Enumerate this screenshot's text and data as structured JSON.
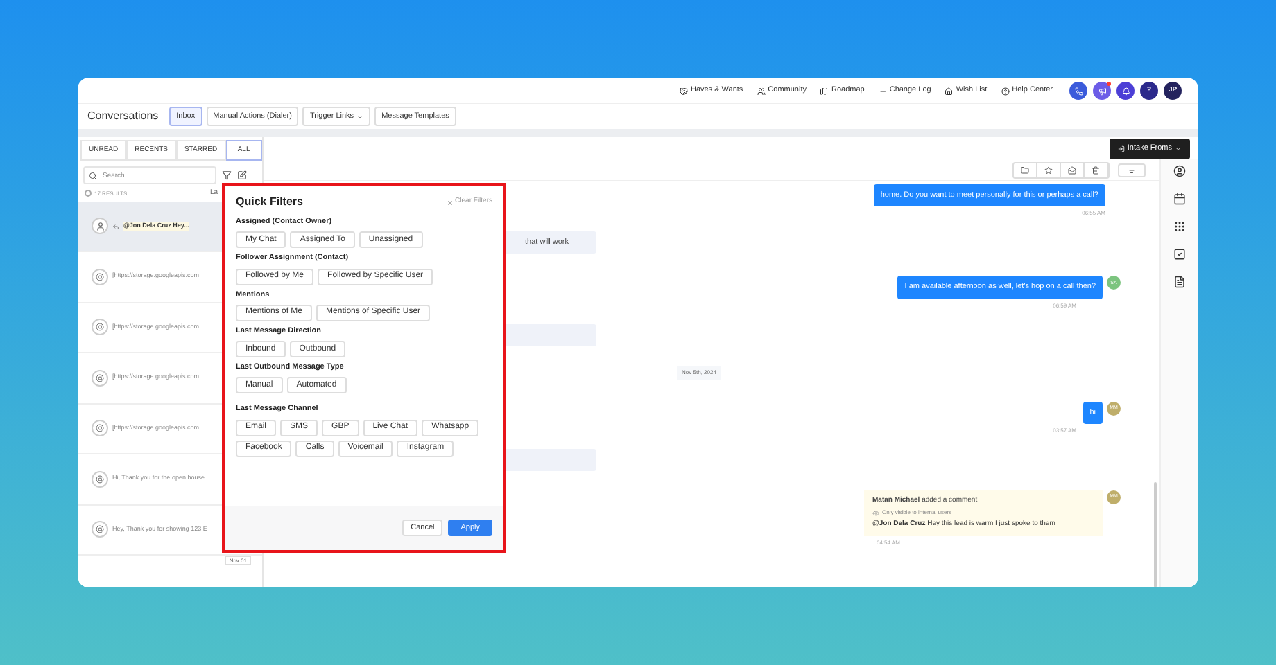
{
  "top_links": [
    "Haves & Wants",
    "Community",
    "Roadmap",
    "Change Log",
    "Wish List",
    "Help Center"
  ],
  "top_buttons": [
    {
      "kind": "phone",
      "color": "#3b5bdb"
    },
    {
      "kind": "megaphone",
      "color": "#6c5ce7",
      "badge": true
    },
    {
      "kind": "bell",
      "color": "#4c3fd6"
    },
    {
      "kind": "help",
      "color": "#2c2a8c",
      "label": "?"
    },
    {
      "kind": "avatar",
      "color": "#24235e",
      "label": "JP"
    }
  ],
  "header": {
    "title": "Conversations",
    "tabs": [
      {
        "label": "Inbox",
        "selected": true,
        "dropdown": false
      },
      {
        "label": "Manual Actions (Dialer)",
        "selected": false,
        "dropdown": false
      },
      {
        "label": "Trigger Links",
        "selected": false,
        "dropdown": true
      },
      {
        "label": "Message Templates",
        "selected": false,
        "dropdown": false
      }
    ]
  },
  "list_tabs": [
    {
      "label": "UNREAD",
      "selected": false
    },
    {
      "label": "RECENTS",
      "selected": false
    },
    {
      "label": "STARRED",
      "selected": false
    },
    {
      "label": "ALL",
      "selected": true
    }
  ],
  "search": {
    "placeholder": "Search"
  },
  "results": "17 RESULTS",
  "select_all_checked": false,
  "sort": "La",
  "conversations": [
    {
      "kind": "person",
      "preview": "@Jon Dela Cruz Hey...",
      "selected": true
    },
    {
      "kind": "at",
      "preview": "[https://storage.googleapis.com",
      "selected": false
    },
    {
      "kind": "at",
      "preview": "[https://storage.googleapis.com",
      "selected": false
    },
    {
      "kind": "at",
      "preview": "[https://storage.googleapis.com",
      "selected": false
    },
    {
      "kind": "at",
      "preview": "[https://storage.googleapis.com",
      "selected": false
    },
    {
      "kind": "at",
      "preview": "Hi, Thank you for the open house",
      "selected": false
    },
    {
      "kind": "at",
      "preview": "Hey, Thank you for showing 123 E",
      "selected": false
    },
    {
      "kind": "date",
      "preview": "Nov 01"
    }
  ],
  "intake_button": "Intake Froms",
  "messages": [
    {
      "kind": "out",
      "text": "home. Do you want to meet personally for this or perhaps a call?",
      "time": "06:55 AM"
    },
    {
      "kind": "in",
      "text": "that will work"
    },
    {
      "kind": "out",
      "text": "I am available afternoon as well, let's hop on a call then?",
      "time": "06:59 AM",
      "avatar": "SA",
      "color": "#7cc47f"
    },
    {
      "kind": "in"
    },
    {
      "kind": "date",
      "text": "Nov 5th, 2024"
    },
    {
      "kind": "out",
      "text": "hi",
      "time": "03:57 AM",
      "avatar": "MM",
      "color": "#bfae6a"
    },
    {
      "kind": "in"
    },
    {
      "kind": "comment",
      "author": "Matan Michael",
      "action": "added a comment",
      "note": "Only visible to internal users",
      "text": "**@Jon Dela Cruz** Hey this lead is warm I just spoke to them",
      "time": "04:54 AM",
      "avatar": "MM",
      "color": "#bfae6a"
    }
  ],
  "filters": {
    "title": "Quick Filters",
    "clear": "Clear Filters",
    "groups": [
      {
        "label": "Assigned (Contact Owner)",
        "options": [
          "My Chat",
          "Assigned To",
          "Unassigned"
        ]
      },
      {
        "label": "Follower Assignment (Contact)",
        "options": [
          "Followed by Me",
          "Followed by Specific User"
        ]
      },
      {
        "label": "Mentions",
        "options": [
          "Mentions of Me",
          "Mentions of Specific User"
        ]
      },
      {
        "label": "Last Message Direction",
        "options": [
          "Inbound",
          "Outbound"
        ]
      },
      {
        "label": "Last Outbound Message Type",
        "options": [
          "Manual",
          "Automated"
        ]
      },
      {
        "label": "Last Message Channel",
        "options": [
          "Email",
          "SMS",
          "GBP",
          "Live Chat",
          "Whatsapp",
          "Facebook",
          "Calls",
          "Voicemail",
          "Instagram"
        ]
      }
    ],
    "cancel": "Cancel",
    "apply": "Apply"
  }
}
